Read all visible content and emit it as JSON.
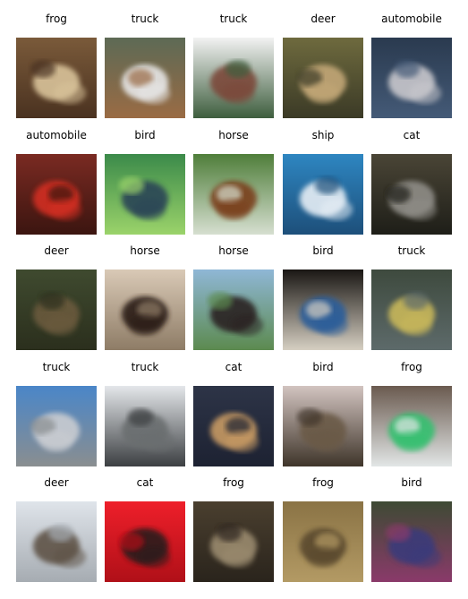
{
  "images": [
    {
      "label": "frog",
      "palette": {
        "bg": "#7a5a3a",
        "fg": "#d9c39a",
        "accent": "#4a3220"
      }
    },
    {
      "label": "truck",
      "palette": {
        "bg": "#5d6a55",
        "fg": "#e6e6e6",
        "accent": "#9a6b44"
      }
    },
    {
      "label": "truck",
      "palette": {
        "bg": "#f2f2f2",
        "fg": "#7b4a3a",
        "accent": "#3e5e3e"
      }
    },
    {
      "label": "deer",
      "palette": {
        "bg": "#6e6a3e",
        "fg": "#c3a777",
        "accent": "#3b3a26"
      }
    },
    {
      "label": "automobile",
      "palette": {
        "bg": "#2a3a4f",
        "fg": "#c8c7cc",
        "accent": "#445a77"
      }
    },
    {
      "label": "automobile",
      "palette": {
        "bg": "#7a2a22",
        "fg": "#d12f24",
        "accent": "#3b1510"
      }
    },
    {
      "label": "bird",
      "palette": {
        "bg": "#3b8a4a",
        "fg": "#2b4456",
        "accent": "#9bd36a"
      }
    },
    {
      "label": "horse",
      "palette": {
        "bg": "#4f7e3a",
        "fg": "#7a3f1f",
        "accent": "#d6dfd0"
      }
    },
    {
      "label": "ship",
      "palette": {
        "bg": "#2e86c1",
        "fg": "#e6eef5",
        "accent": "#1d4f7a"
      }
    },
    {
      "label": "cat",
      "palette": {
        "bg": "#4a4536",
        "fg": "#8f8d87",
        "accent": "#1e1e18"
      }
    },
    {
      "label": "deer",
      "palette": {
        "bg": "#3f4a2f",
        "fg": "#6a5a3c",
        "accent": "#2b2f1d"
      }
    },
    {
      "label": "horse",
      "palette": {
        "bg": "#d9c9b6",
        "fg": "#2a1b12",
        "accent": "#8e7c66"
      }
    },
    {
      "label": "horse",
      "palette": {
        "bg": "#8fb7d6",
        "fg": "#2a2320",
        "accent": "#5c8a4f"
      }
    },
    {
      "label": "bird",
      "palette": {
        "bg": "#1a1714",
        "fg": "#2a5d9a",
        "accent": "#d6cfc2"
      }
    },
    {
      "label": "truck",
      "palette": {
        "bg": "#3e4a3e",
        "fg": "#c8b75a",
        "accent": "#5d6a6a"
      }
    },
    {
      "label": "truck",
      "palette": {
        "bg": "#4a86c8",
        "fg": "#c9ccd1",
        "accent": "#8a8e90"
      }
    },
    {
      "label": "truck",
      "palette": {
        "bg": "#e4e7ea",
        "fg": "#6a6e70",
        "accent": "#3c3f42"
      }
    },
    {
      "label": "cat",
      "palette": {
        "bg": "#2d3447",
        "fg": "#c79a63",
        "accent": "#1d2232"
      }
    },
    {
      "label": "bird",
      "palette": {
        "bg": "#d2c4c0",
        "fg": "#6a5a47",
        "accent": "#3f352a"
      }
    },
    {
      "label": "frog",
      "palette": {
        "bg": "#6a5a4f",
        "fg": "#36c070",
        "accent": "#e2e6e6"
      }
    },
    {
      "label": "deer",
      "palette": {
        "bg": "#dfe4ea",
        "fg": "#5e5246",
        "accent": "#a6acb2"
      }
    },
    {
      "label": "cat",
      "palette": {
        "bg": "#ee1f2a",
        "fg": "#2a1a1a",
        "accent": "#b01018"
      }
    },
    {
      "label": "frog",
      "palette": {
        "bg": "#4a3f2f",
        "fg": "#9a8a6e",
        "accent": "#2a241c"
      }
    },
    {
      "label": "frog",
      "palette": {
        "bg": "#8a7345",
        "fg": "#5a4a2f",
        "accent": "#b39a64"
      }
    },
    {
      "label": "bird",
      "palette": {
        "bg": "#3e4a34",
        "fg": "#3a3a7a",
        "accent": "#8a3a6a"
      }
    }
  ]
}
